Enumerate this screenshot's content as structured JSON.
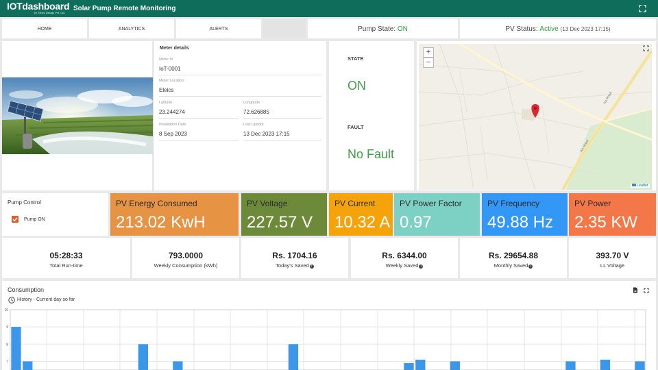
{
  "header": {
    "logo_text": "IOTdashboard",
    "logo_subtext": "by Eleics Design Pvt. Ltd.",
    "title": "Solar Pump Remote Monitoring"
  },
  "nav": {
    "tabs": [
      {
        "label": "HOME"
      },
      {
        "label": "ANALYTICS"
      },
      {
        "label": "ALERTS"
      }
    ]
  },
  "status": {
    "pump_state_label": "Pump State:",
    "pump_state_value": "ON",
    "pv_status_label": "PV Status:",
    "pv_status_value": "Active",
    "pv_status_time": "(13 Dec 2023 17:15)"
  },
  "meter": {
    "title": "Meter details",
    "meter_id_label": "Meter id",
    "meter_id": "IoT-0001",
    "location_label": "Meter Location",
    "location": "Eleics",
    "latitude_label": "Latitude",
    "latitude": "23.244274",
    "longitude_label": "Longitude",
    "longitude": "72.626885",
    "install_label": "Installation Date",
    "install_date": "8 Sep 2023",
    "update_label": "Last Update",
    "update_date": "13 Dec 2023 17:15"
  },
  "state_card": {
    "state_label": "STATE",
    "state_value": "ON",
    "fault_label": "FAULT",
    "fault_value": "No Fault"
  },
  "map": {
    "zoom_in": "+",
    "zoom_out": "−",
    "road_label_1": "Ka Road",
    "road_label_2": "Kh Road",
    "attribution": "Leaflet"
  },
  "pump_control": {
    "title": "Pump Control",
    "checkbox_label": "Pump ON",
    "checked": true
  },
  "metrics": [
    {
      "label": "PV Energy Consumed",
      "value": "213.02 KwH",
      "color": "#e69344"
    },
    {
      "label": "PV Voltage",
      "value": "227.57 V",
      "color": "#6d8a3a"
    },
    {
      "label": "PV Current",
      "value": "10.32 A",
      "color": "#f5a30a"
    },
    {
      "label": "PV Power Factor",
      "value": "0.97",
      "color": "#7dd1c4"
    },
    {
      "label": "PV Frequency",
      "value": "49.88 Hz",
      "color": "#3397f5"
    },
    {
      "label": "PV Power",
      "value": "2.35 KW",
      "color": "#f4774a"
    }
  ],
  "stats": [
    {
      "value": "05:28:33",
      "label": "Total Run-time",
      "info": false
    },
    {
      "value": "793.0000",
      "label": "Weekly Consumption (kWh)",
      "info": false
    },
    {
      "value": "Rs. 1704.16",
      "label": "Today's Saved",
      "info": true
    },
    {
      "value": "Rs. 6344.00",
      "label": "Weekly Saved",
      "info": true
    },
    {
      "value": "Rs. 29654.88",
      "label": "Monthly Saved",
      "info": true
    },
    {
      "value": "393.70 V",
      "label": "LL Voltage",
      "info": false
    }
  ],
  "consumption": {
    "title": "Consumption",
    "subtitle": "History - Current day so far"
  },
  "chart_data": {
    "type": "bar",
    "ylim": [
      6.5,
      10
    ],
    "yticks": [
      "10",
      "9",
      "8",
      "7"
    ],
    "grid": true,
    "bar_color": "#3d97e8",
    "values": [
      9.0,
      7.0,
      0,
      0,
      0,
      0,
      0,
      0,
      0,
      0,
      0,
      8.0,
      0,
      0,
      7.0,
      0,
      0,
      0,
      0,
      0,
      0,
      0,
      0,
      0,
      8.0,
      0,
      0,
      0,
      0,
      0,
      0,
      0,
      0,
      0,
      6.9,
      7.1,
      0,
      0,
      7.0,
      0,
      0,
      0,
      0,
      0,
      0,
      0,
      0,
      0,
      7.0,
      0,
      0,
      7.1,
      0,
      0,
      7.0
    ]
  }
}
